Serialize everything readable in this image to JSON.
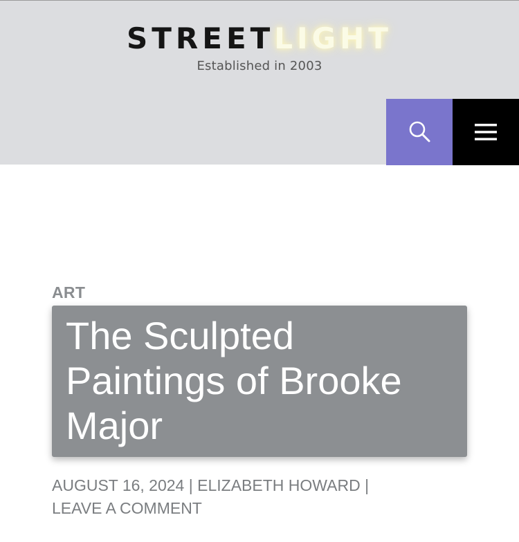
{
  "header": {
    "logo_part1": "STREET",
    "logo_part2": "LIGHT",
    "tagline": "Established in 2003",
    "search_icon": "search-icon",
    "menu_icon": "hamburger-menu-icon",
    "colors": {
      "header_bg": "#dcdde0",
      "search_button_bg": "#7a75cc",
      "menu_button_bg": "#000000"
    }
  },
  "post": {
    "category": "ART",
    "title": "The Sculpted Paintings of Brooke Major",
    "date": "AUGUST 16, 2024",
    "separator": "|",
    "author": "ELIZABETH HOWARD",
    "comment_link": "LEAVE A COMMENT",
    "colors": {
      "title_bg": "#8c8f92",
      "meta_text": "#7a7d80"
    }
  }
}
